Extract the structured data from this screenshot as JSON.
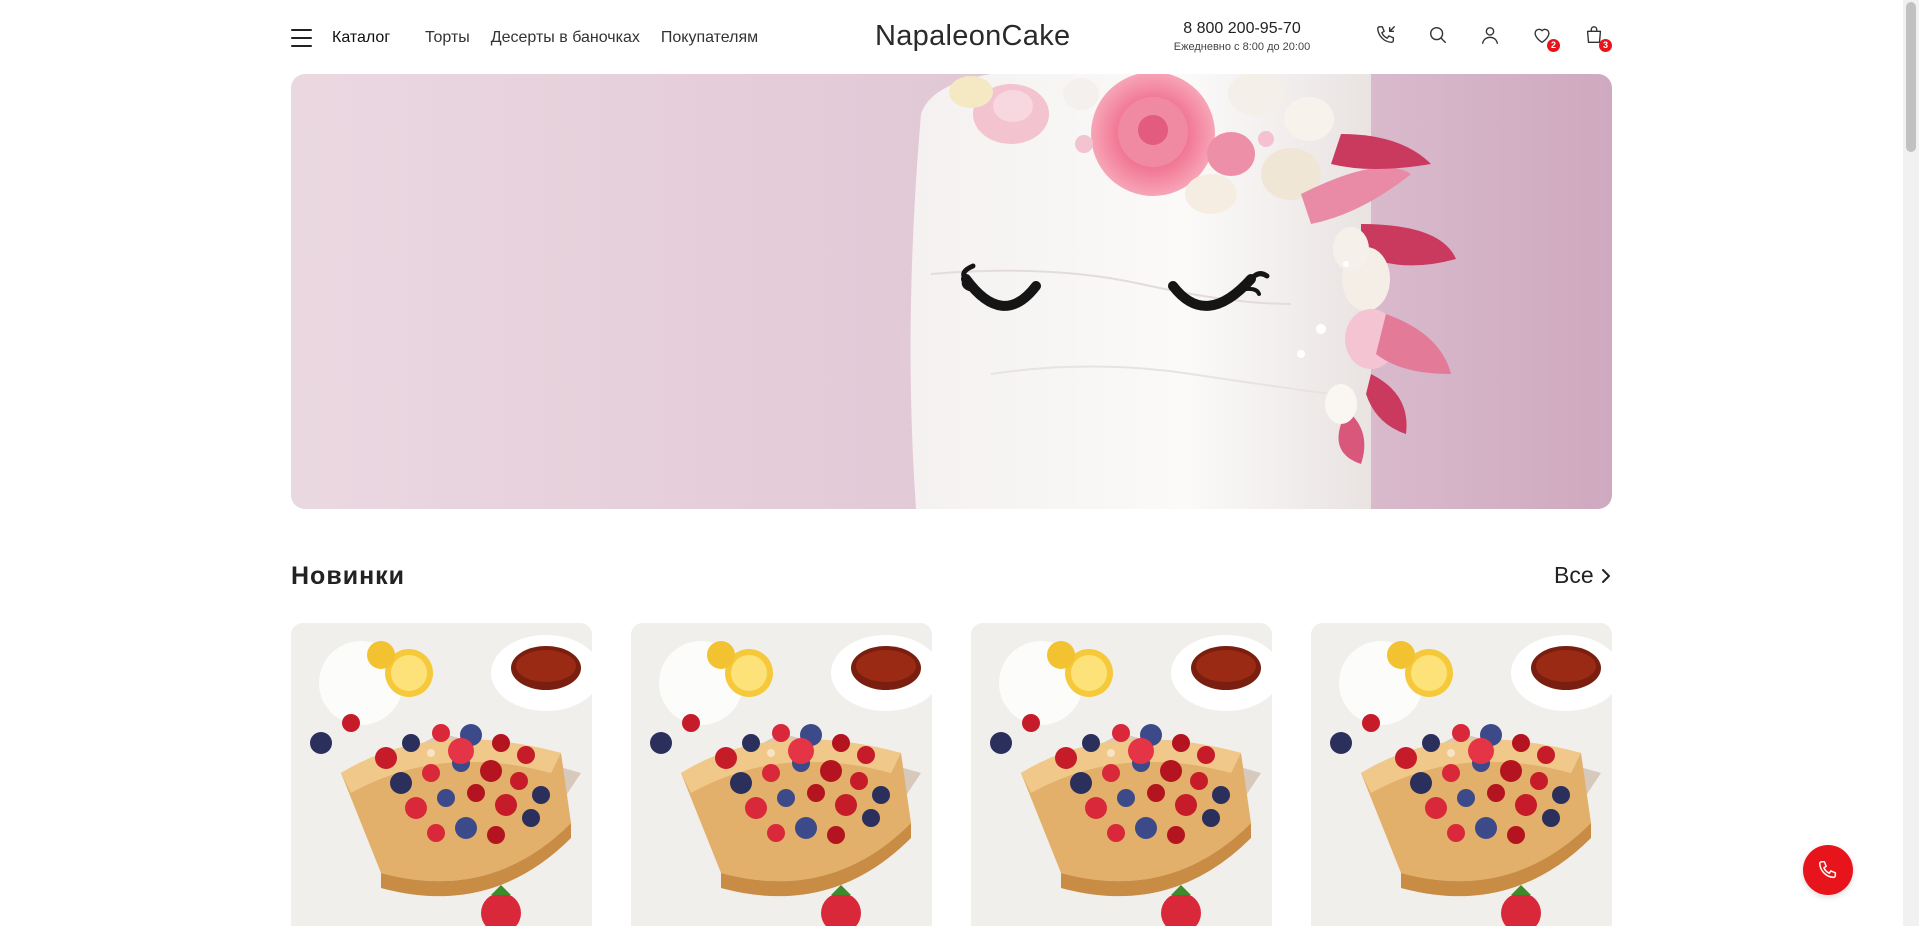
{
  "header": {
    "catalog_label": "Каталог",
    "nav": [
      "Торты",
      "Десерты в баночках",
      "Покупателям"
    ],
    "logo": "NapaleonCake",
    "phone": "8 800 200-95-70",
    "hours": "Ежедневно с 8:00 до 20:00",
    "icons": [
      "phone-callback-icon",
      "search-icon",
      "user-icon",
      "heart-icon",
      "bag-icon"
    ],
    "favorites_count": "2",
    "cart_count": "3"
  },
  "hero": {
    "image": "unicorn cake with pink meringues on pink background"
  },
  "new_section": {
    "title": "Новинки",
    "all_label": "Все",
    "cards": [
      {
        "image": "napoleon cake with berries"
      },
      {
        "image": "napoleon cake with berries"
      },
      {
        "image": "napoleon cake with berries"
      },
      {
        "image": "napoleon cake with berries"
      }
    ]
  },
  "colors": {
    "accent": "#e8141b",
    "text": "#222222",
    "hero_bg": "#e3cad7"
  }
}
